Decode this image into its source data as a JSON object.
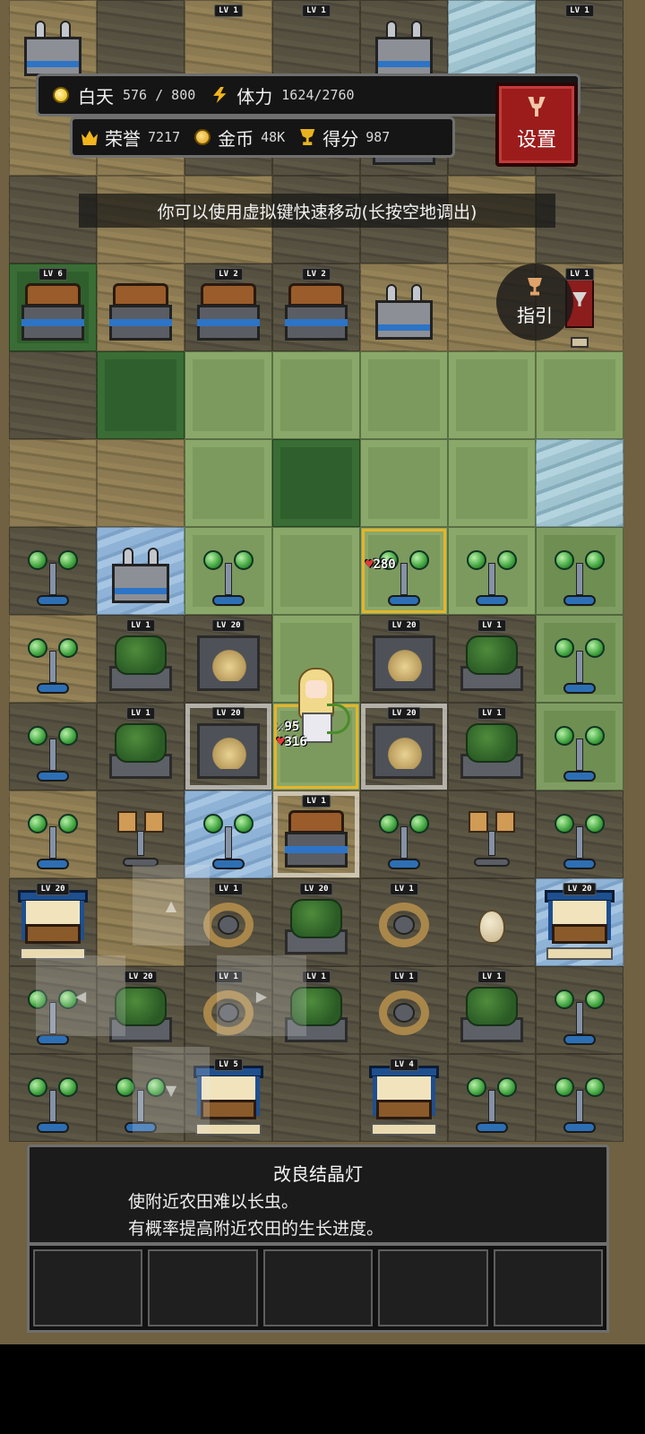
{
  "hud": {
    "day_label": "白天",
    "day_value": "576 / 800",
    "stamina_label": "体力",
    "stamina_value": "1624/2760",
    "honor_label": "荣誉",
    "honor_value": "7217",
    "gold_label": "金币",
    "gold_value": "48K",
    "score_label": "得分",
    "score_value": "987"
  },
  "settings": {
    "label": "设置"
  },
  "hint": "你可以使用虚拟键快速移动(长按空地调出)",
  "guide": {
    "label": "指引"
  },
  "player": {
    "attack": "95",
    "hp": "316"
  },
  "target_hp": "280",
  "info_panel": {
    "title": "改良结晶灯",
    "line1": "使附近农田难以长虫。",
    "line2": "有概率提高附近农田的生长进度。"
  },
  "slots": [
    "",
    "",
    "",
    "",
    ""
  ],
  "grid": [
    [
      {
        "t": "t-light",
        "o": "machine",
        "lv": ""
      },
      {
        "t": "t-dark",
        "o": "",
        "lv": ""
      },
      {
        "t": "t-light",
        "o": "",
        "lv": "LV 1"
      },
      {
        "t": "t-dark",
        "o": "",
        "lv": "LV 1"
      },
      {
        "t": "t-dark",
        "o": "machine",
        "lv": ""
      },
      {
        "t": "t-water",
        "o": "",
        "lv": ""
      },
      {
        "t": "t-dark",
        "o": "",
        "lv": "LV 1"
      }
    ],
    [
      {
        "t": "t-light",
        "o": "",
        "lv": ""
      },
      {
        "t": "t-light",
        "o": "",
        "lv": ""
      },
      {
        "t": "t-dark",
        "o": "",
        "lv": ""
      },
      {
        "t": "t-dark",
        "o": "",
        "lv": ""
      },
      {
        "t": "t-dark",
        "o": "chest",
        "lv": ""
      },
      {
        "t": "t-dark",
        "o": "",
        "lv": ""
      },
      {
        "t": "t-dark",
        "o": "",
        "lv": ""
      }
    ],
    [
      {
        "t": "t-dark",
        "o": "",
        "lv": ""
      },
      {
        "t": "t-light",
        "o": "",
        "lv": ""
      },
      {
        "t": "t-light",
        "o": "",
        "lv": ""
      },
      {
        "t": "t-dark",
        "o": "",
        "lv": ""
      },
      {
        "t": "t-dark",
        "o": "",
        "lv": ""
      },
      {
        "t": "t-light",
        "o": "",
        "lv": ""
      },
      {
        "t": "t-dark",
        "o": "",
        "lv": ""
      }
    ],
    [
      {
        "t": "t-dgrass",
        "o": "chest",
        "lv": "LV 6"
      },
      {
        "t": "t-light",
        "o": "chest",
        "lv": ""
      },
      {
        "t": "t-dark",
        "o": "chest",
        "lv": "LV 2"
      },
      {
        "t": "t-dark",
        "o": "chest",
        "lv": "LV 2"
      },
      {
        "t": "t-light",
        "o": "machine",
        "lv": ""
      },
      {
        "t": "t-light",
        "o": "",
        "lv": ""
      },
      {
        "t": "t-light",
        "o": "banner",
        "lv": "LV 1"
      }
    ],
    [
      {
        "t": "t-dark",
        "o": "",
        "lv": ""
      },
      {
        "t": "t-dgrass",
        "o": "",
        "lv": ""
      },
      {
        "t": "t-grass",
        "o": "",
        "lv": ""
      },
      {
        "t": "t-grass",
        "o": "",
        "lv": ""
      },
      {
        "t": "t-grass",
        "o": "",
        "lv": ""
      },
      {
        "t": "t-grass",
        "o": "",
        "lv": ""
      },
      {
        "t": "t-grass",
        "o": "",
        "lv": ""
      }
    ],
    [
      {
        "t": "t-light",
        "o": "",
        "lv": ""
      },
      {
        "t": "t-light",
        "o": "",
        "lv": ""
      },
      {
        "t": "t-grass",
        "o": "",
        "lv": ""
      },
      {
        "t": "t-dgrass",
        "o": "",
        "lv": ""
      },
      {
        "t": "t-grass",
        "o": "",
        "lv": ""
      },
      {
        "t": "t-grass",
        "o": "",
        "lv": ""
      },
      {
        "t": "t-water",
        "o": "",
        "lv": ""
      }
    ],
    [
      {
        "t": "t-dark",
        "o": "lamp",
        "lv": ""
      },
      {
        "t": "t-ice",
        "o": "machine",
        "lv": ""
      },
      {
        "t": "t-grass",
        "o": "lamp",
        "lv": ""
      },
      {
        "t": "t-grass",
        "o": "",
        "lv": ""
      },
      {
        "t": "t-grass hl-gold",
        "o": "lamp",
        "lv": ""
      },
      {
        "t": "t-grass",
        "o": "lamp",
        "lv": ""
      },
      {
        "t": "t-grass2",
        "o": "lamp",
        "lv": ""
      }
    ],
    [
      {
        "t": "t-light",
        "o": "lamp",
        "lv": ""
      },
      {
        "t": "t-dark",
        "o": "planter",
        "lv": "LV 1"
      },
      {
        "t": "t-dark",
        "o": "bed",
        "lv": "LV 20"
      },
      {
        "t": "t-grass",
        "o": "",
        "lv": ""
      },
      {
        "t": "t-dark",
        "o": "bed",
        "lv": "LV 20"
      },
      {
        "t": "t-dark",
        "o": "planter",
        "lv": "LV 1"
      },
      {
        "t": "t-grass2",
        "o": "lamp",
        "lv": ""
      }
    ],
    [
      {
        "t": "t-dark",
        "o": "lamp",
        "lv": ""
      },
      {
        "t": "t-dark",
        "o": "planter",
        "lv": "LV 1"
      },
      {
        "t": "t-dark hl-white",
        "o": "bed",
        "lv": "LV 20"
      },
      {
        "t": "t-grass hl-gold",
        "o": "",
        "lv": ""
      },
      {
        "t": "t-dark hl-white",
        "o": "bed",
        "lv": "LV 20"
      },
      {
        "t": "t-dark",
        "o": "planter",
        "lv": "LV 1"
      },
      {
        "t": "t-grass2",
        "o": "lamp",
        "lv": ""
      }
    ],
    [
      {
        "t": "t-light",
        "o": "lamp",
        "lv": ""
      },
      {
        "t": "t-dark",
        "o": "boxes",
        "lv": ""
      },
      {
        "t": "t-ice",
        "o": "lamp",
        "lv": ""
      },
      {
        "t": "t-light hl-white",
        "o": "chest",
        "lv": "LV 1"
      },
      {
        "t": "t-dark",
        "o": "lamp",
        "lv": ""
      },
      {
        "t": "t-dark",
        "o": "boxes",
        "lv": ""
      },
      {
        "t": "t-dark",
        "o": "lamp",
        "lv": ""
      }
    ],
    [
      {
        "t": "t-dark",
        "o": "stall",
        "lv": "LV 20"
      },
      {
        "t": "t-light",
        "o": "",
        "lv": ""
      },
      {
        "t": "t-dark",
        "o": "straw",
        "lv": "LV 1"
      },
      {
        "t": "t-dark",
        "o": "planter",
        "lv": "LV 20"
      },
      {
        "t": "t-dark",
        "o": "straw",
        "lv": "LV 1"
      },
      {
        "t": "t-dark",
        "o": "seed",
        "lv": ""
      },
      {
        "t": "t-ice",
        "o": "stall",
        "lv": "LV 20"
      }
    ],
    [
      {
        "t": "t-dark",
        "o": "lamp",
        "lv": ""
      },
      {
        "t": "t-dark",
        "o": "planter",
        "lv": "LV 20"
      },
      {
        "t": "t-dark",
        "o": "straw",
        "lv": "LV 1"
      },
      {
        "t": "t-dark",
        "o": "planter",
        "lv": "LV 1"
      },
      {
        "t": "t-dark",
        "o": "straw",
        "lv": "LV 1"
      },
      {
        "t": "t-dark",
        "o": "planter",
        "lv": "LV 1"
      },
      {
        "t": "t-dark",
        "o": "lamp",
        "lv": ""
      }
    ],
    [
      {
        "t": "t-dark",
        "o": "lamp",
        "lv": ""
      },
      {
        "t": "t-dark",
        "o": "lamp",
        "lv": ""
      },
      {
        "t": "t-dark",
        "o": "stall",
        "lv": "LV 5"
      },
      {
        "t": "t-dark",
        "o": "",
        "lv": ""
      },
      {
        "t": "t-dark",
        "o": "stall",
        "lv": "LV 4"
      },
      {
        "t": "t-dark",
        "o": "lamp",
        "lv": ""
      },
      {
        "t": "t-dark",
        "o": "lamp",
        "lv": ""
      }
    ]
  ]
}
